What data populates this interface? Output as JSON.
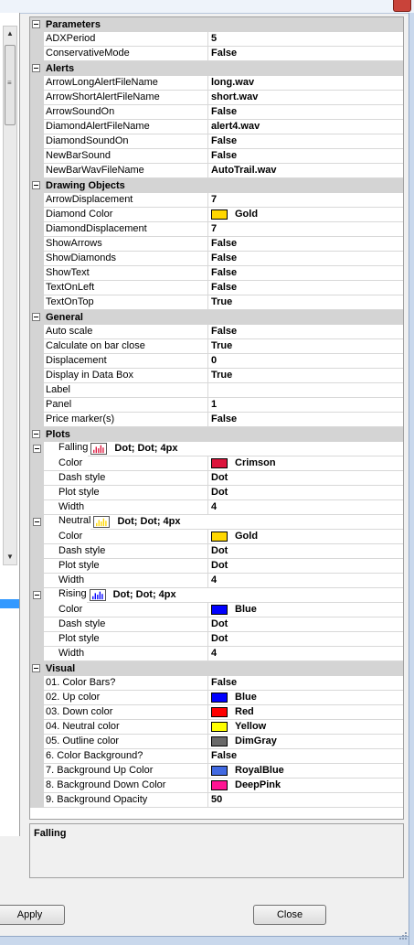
{
  "description_panel": {
    "title": "Falling"
  },
  "buttons": {
    "apply": "Apply",
    "close": "Close"
  },
  "colors": {
    "Gold": "#FFD700",
    "Crimson": "#DC143C",
    "Blue": "#0000FF",
    "Red": "#FF0000",
    "Yellow": "#FFFF00",
    "DimGray": "#696969",
    "RoyalBlue": "#4169E1",
    "DeepPink": "#FF1493"
  },
  "grid": [
    {
      "kind": "cat",
      "label": "Parameters"
    },
    {
      "kind": "prop",
      "name": "ADXPeriod",
      "value": "5"
    },
    {
      "kind": "prop",
      "name": "ConservativeMode",
      "value": "False"
    },
    {
      "kind": "cat",
      "label": "Alerts"
    },
    {
      "kind": "prop",
      "name": "ArrowLongAlertFileName",
      "value": "long.wav"
    },
    {
      "kind": "prop",
      "name": "ArrowShortAlertFileName",
      "value": "short.wav"
    },
    {
      "kind": "prop",
      "name": "ArrowSoundOn",
      "value": "False"
    },
    {
      "kind": "prop",
      "name": "DiamondAlertFileName",
      "value": "alert4.wav"
    },
    {
      "kind": "prop",
      "name": "DiamondSoundOn",
      "value": "False"
    },
    {
      "kind": "prop",
      "name": "NewBarSound",
      "value": "False"
    },
    {
      "kind": "prop",
      "name": "NewBarWavFileName",
      "value": "AutoTrail.wav"
    },
    {
      "kind": "cat",
      "label": "Drawing Objects"
    },
    {
      "kind": "prop",
      "name": "ArrowDisplacement",
      "value": "7"
    },
    {
      "kind": "prop",
      "name": "Diamond Color",
      "value": "Gold",
      "swatch": "Gold"
    },
    {
      "kind": "prop",
      "name": "DiamondDisplacement",
      "value": "7"
    },
    {
      "kind": "prop",
      "name": "ShowArrows",
      "value": "False"
    },
    {
      "kind": "prop",
      "name": "ShowDiamonds",
      "value": "False"
    },
    {
      "kind": "prop",
      "name": "ShowText",
      "value": "False"
    },
    {
      "kind": "prop",
      "name": "TextOnLeft",
      "value": "False"
    },
    {
      "kind": "prop",
      "name": "TextOnTop",
      "value": "True"
    },
    {
      "kind": "cat",
      "label": "General"
    },
    {
      "kind": "prop",
      "name": "Auto scale",
      "value": "False"
    },
    {
      "kind": "prop",
      "name": "Calculate on bar close",
      "value": "True"
    },
    {
      "kind": "prop",
      "name": "Displacement",
      "value": "0"
    },
    {
      "kind": "prop",
      "name": "Display in Data Box",
      "value": "True"
    },
    {
      "kind": "prop",
      "name": "Label",
      "value": ""
    },
    {
      "kind": "prop",
      "name": "Panel",
      "value": "1"
    },
    {
      "kind": "prop",
      "name": "Price marker(s)",
      "value": "False"
    },
    {
      "kind": "cat",
      "label": "Plots"
    },
    {
      "kind": "group",
      "name": "Falling",
      "value": "Dot; Dot; 4px",
      "plot": "Crimson"
    },
    {
      "kind": "sub",
      "name": "Color",
      "value": "Crimson",
      "swatch": "Crimson"
    },
    {
      "kind": "sub",
      "name": "Dash style",
      "value": "Dot"
    },
    {
      "kind": "sub",
      "name": "Plot style",
      "value": "Dot"
    },
    {
      "kind": "sub",
      "name": "Width",
      "value": "4"
    },
    {
      "kind": "group",
      "name": "Neutral",
      "value": "Dot; Dot; 4px",
      "plot": "Gold"
    },
    {
      "kind": "sub",
      "name": "Color",
      "value": "Gold",
      "swatch": "Gold"
    },
    {
      "kind": "sub",
      "name": "Dash style",
      "value": "Dot"
    },
    {
      "kind": "sub",
      "name": "Plot style",
      "value": "Dot"
    },
    {
      "kind": "sub",
      "name": "Width",
      "value": "4"
    },
    {
      "kind": "group",
      "name": "Rising",
      "value": "Dot; Dot; 4px",
      "plot": "Blue"
    },
    {
      "kind": "sub",
      "name": "Color",
      "value": "Blue",
      "swatch": "Blue"
    },
    {
      "kind": "sub",
      "name": "Dash style",
      "value": "Dot"
    },
    {
      "kind": "sub",
      "name": "Plot style",
      "value": "Dot"
    },
    {
      "kind": "sub",
      "name": "Width",
      "value": "4"
    },
    {
      "kind": "cat",
      "label": "Visual"
    },
    {
      "kind": "prop",
      "name": "01. Color Bars?",
      "value": "False"
    },
    {
      "kind": "prop",
      "name": "02. Up color",
      "value": "Blue",
      "swatch": "Blue"
    },
    {
      "kind": "prop",
      "name": "03. Down color",
      "value": "Red",
      "swatch": "Red"
    },
    {
      "kind": "prop",
      "name": "04. Neutral color",
      "value": "Yellow",
      "swatch": "Yellow"
    },
    {
      "kind": "prop",
      "name": "05. Outline color",
      "value": "DimGray",
      "swatch": "DimGray"
    },
    {
      "kind": "prop",
      "name": "6. Color Background?",
      "value": "False"
    },
    {
      "kind": "prop",
      "name": "7. Background Up Color",
      "value": "RoyalBlue",
      "swatch": "RoyalBlue"
    },
    {
      "kind": "prop",
      "name": "8. Background Down Color",
      "value": "DeepPink",
      "swatch": "DeepPink"
    },
    {
      "kind": "prop",
      "name": "9. Background Opacity",
      "value": "50"
    }
  ]
}
